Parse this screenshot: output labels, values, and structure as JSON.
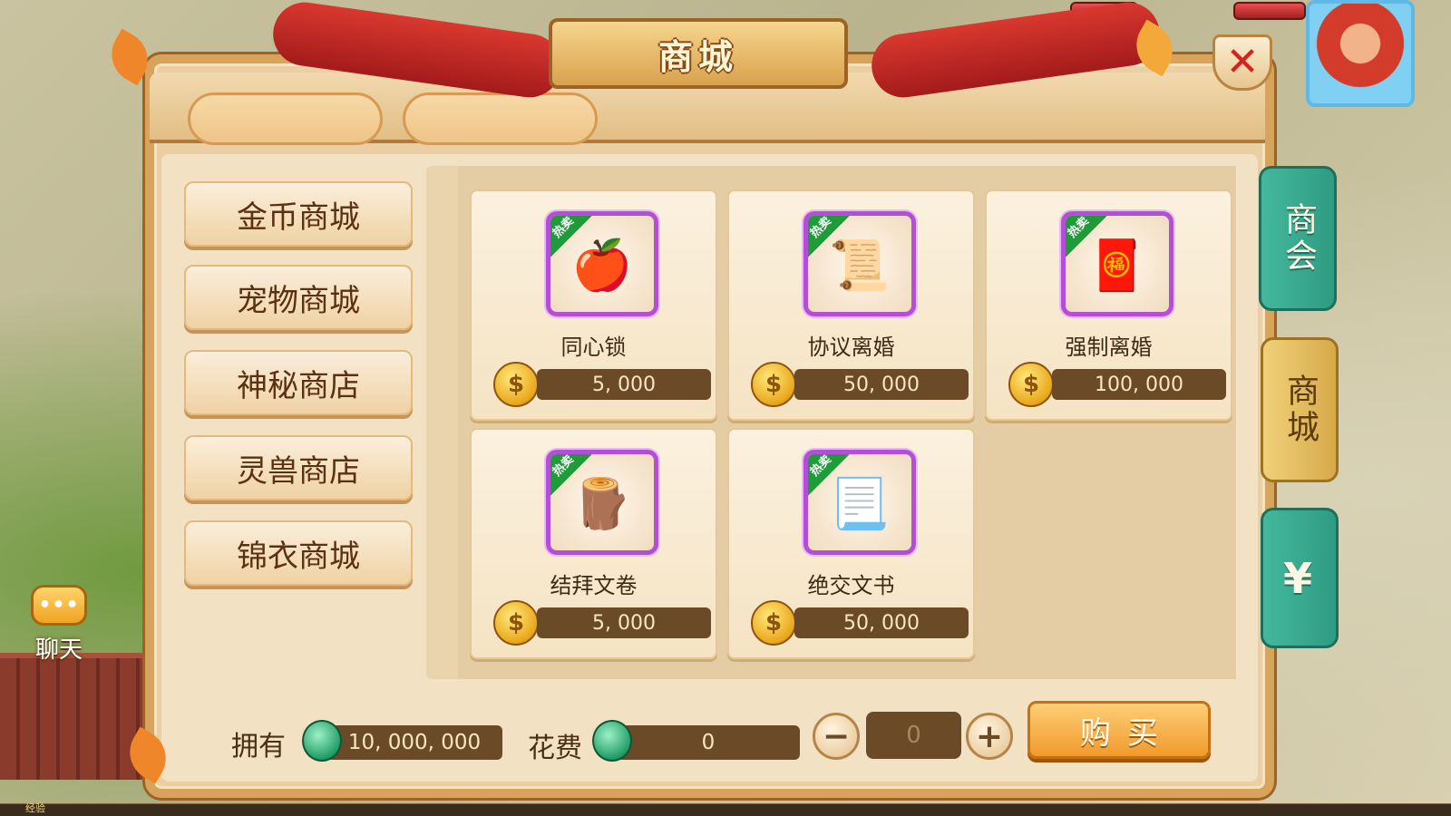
{
  "window": {
    "title": "商城",
    "close_symbol": "✕"
  },
  "categories": [
    {
      "label": "金币商城"
    },
    {
      "label": "宠物商城"
    },
    {
      "label": "神秘商店"
    },
    {
      "label": "灵兽商店"
    },
    {
      "label": "锦衣商城"
    }
  ],
  "items": [
    {
      "name": "同心锁",
      "price": "5, 000",
      "tag": "热卖",
      "glyph": "🍎"
    },
    {
      "name": "协议离婚",
      "price": "50, 000",
      "tag": "热卖",
      "glyph": "📜"
    },
    {
      "name": "强制离婚",
      "price": "100, 000",
      "tag": "热卖",
      "glyph": "🧧"
    },
    {
      "name": "结拜文卷",
      "price": "5, 000",
      "tag": "热卖",
      "glyph": "🪵"
    },
    {
      "name": "绝交文书",
      "price": "50, 000",
      "tag": "热卖",
      "glyph": "📃"
    }
  ],
  "side_tabs": [
    {
      "label": "商会",
      "color": "#43b89d"
    },
    {
      "label": "商城",
      "color": "#efd27a"
    },
    {
      "label": "¥",
      "color": "#43b89d"
    }
  ],
  "footer": {
    "own_label": "拥有",
    "own_value": "10, 000, 000",
    "cost_label": "花费",
    "cost_value": "0",
    "quantity": "0",
    "minus_symbol": "−",
    "plus_symbol": "+",
    "buy_label": "购买"
  },
  "hud": {
    "chat_label": "聊天",
    "chat_bubble": "•••",
    "exp_label": "经验"
  },
  "colors": {
    "accent_purple": "#b34fd6",
    "hot_tag_green": "#1f9b3a",
    "price_bar_brown": "#6b4a28",
    "close_red": "#d6221c"
  }
}
